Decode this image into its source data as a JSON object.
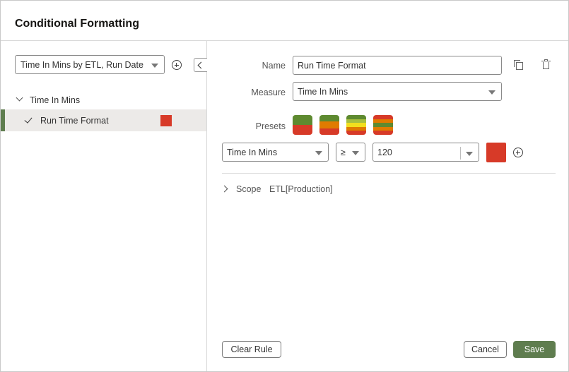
{
  "dialog": {
    "title": "Conditional Formatting"
  },
  "left": {
    "rule_select": {
      "value": "Time In Mins by ETL, Run Date"
    },
    "tree": {
      "group_label": "Time In Mins",
      "items": [
        {
          "label": "Run Time Format",
          "checked": true,
          "color": "#d73a28"
        }
      ]
    }
  },
  "form": {
    "name_label": "Name",
    "name_value": "Run Time Format",
    "measure_label": "Measure",
    "measure_value": "Time In Mins",
    "presets_label": "Presets",
    "presets": [
      {
        "name": "two-color",
        "colors": [
          "#5e8a30",
          "#d73a28"
        ]
      },
      {
        "name": "three-color",
        "colors": [
          "#5e8a30",
          "#e07b00",
          "#d73a28"
        ]
      },
      {
        "name": "five-color",
        "colors": [
          "#5e8a30",
          "#a7c040",
          "#f2df1d",
          "#e07b00",
          "#d73a28"
        ]
      },
      {
        "name": "alternating",
        "colors": [
          "#d73a28",
          "#e07b00",
          "#5e8a30",
          "#e07b00",
          "#d73a28"
        ]
      }
    ],
    "condition": {
      "measure": "Time In Mins",
      "operator": "≥",
      "value": "120",
      "color": "#d73a28"
    },
    "scope_label": "Scope",
    "scope_value": "ETL[Production]"
  },
  "buttons": {
    "clear_rule": "Clear Rule",
    "cancel": "Cancel",
    "save": "Save"
  },
  "colors": {
    "accent": "#5f7d4f",
    "rule_color": "#d73a28"
  }
}
